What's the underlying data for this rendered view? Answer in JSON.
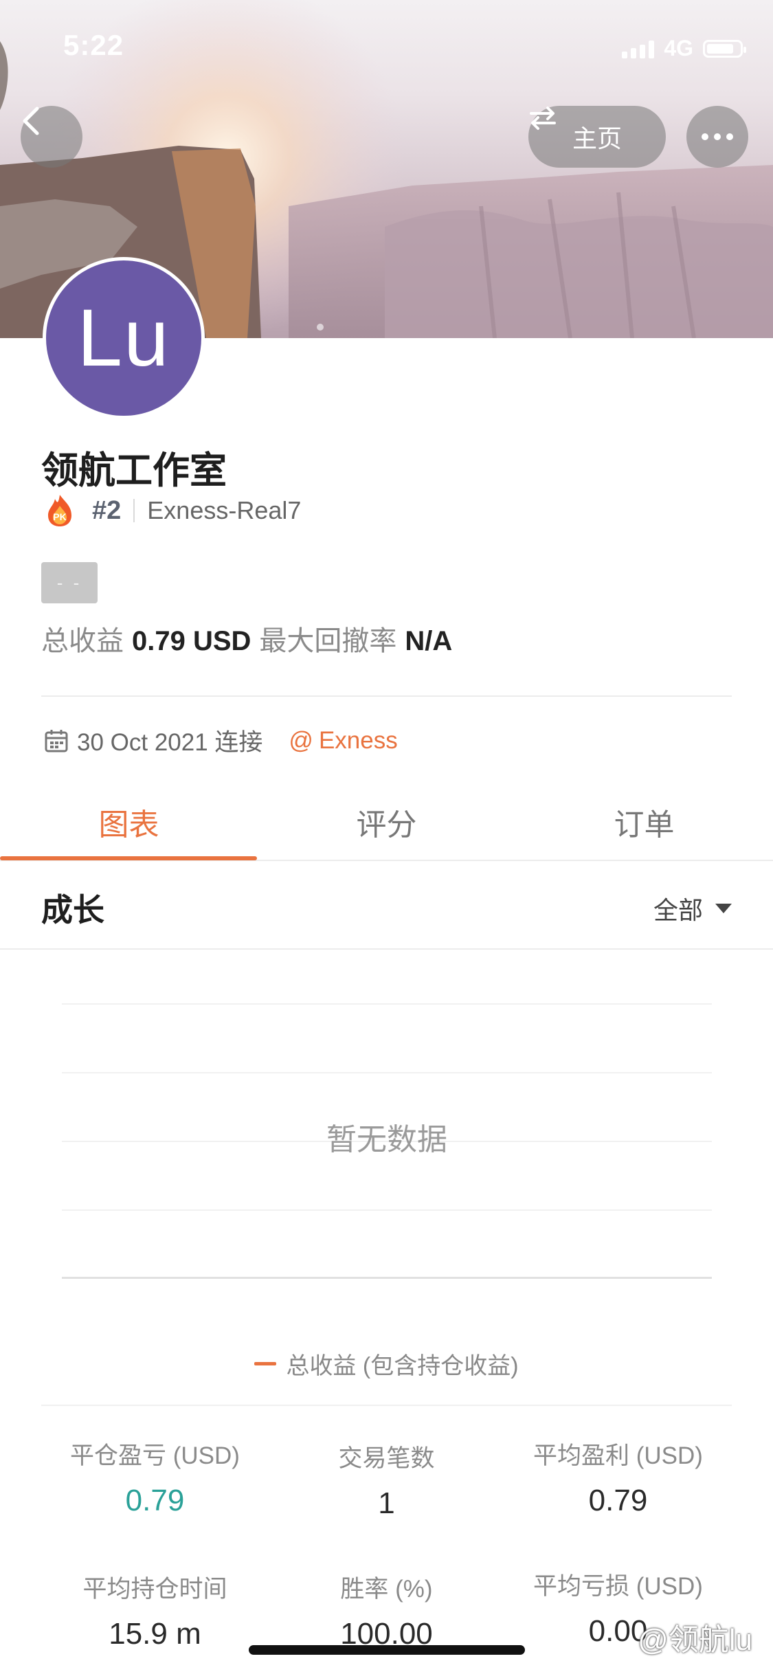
{
  "status_bar": {
    "time": "5:22",
    "network": "4G"
  },
  "header": {
    "home_label": "主页"
  },
  "profile": {
    "avatar_text": "Lu",
    "name": "领航工作室",
    "rank": "#2",
    "server": "Exness-Real7",
    "badge_text": "PK",
    "grey_tag": "- -",
    "total_profit_label": "总收益",
    "total_profit_value": "0.79 USD",
    "max_drawdown_label": "最大回撤率",
    "max_drawdown_value": "N/A",
    "connected_date": "30 Oct 2021 连接",
    "broker": "Exness"
  },
  "tabs": [
    {
      "label": "图表",
      "active": true
    },
    {
      "label": "评分",
      "active": false
    },
    {
      "label": "订单",
      "active": false
    }
  ],
  "growth": {
    "title": "成长",
    "filter": "全部",
    "empty_text": "暂无数据",
    "legend": "总收益 (包含持仓收益)"
  },
  "metrics": [
    {
      "label": "平仓盈亏 (USD)",
      "value": "0.79"
    },
    {
      "label": "交易笔数",
      "value": "1"
    },
    {
      "label": "平均盈利 (USD)",
      "value": "0.79"
    },
    {
      "label": "平均持仓时间",
      "value": "15.9 m"
    },
    {
      "label": "胜率 (%)",
      "value": "100.00"
    },
    {
      "label": "平均亏损 (USD)",
      "value": "0.00"
    }
  ],
  "watermark": "@领航lu",
  "colors": {
    "accent": "#e9733f",
    "avatar": "#6a59a6",
    "positive": "#2aa198"
  }
}
